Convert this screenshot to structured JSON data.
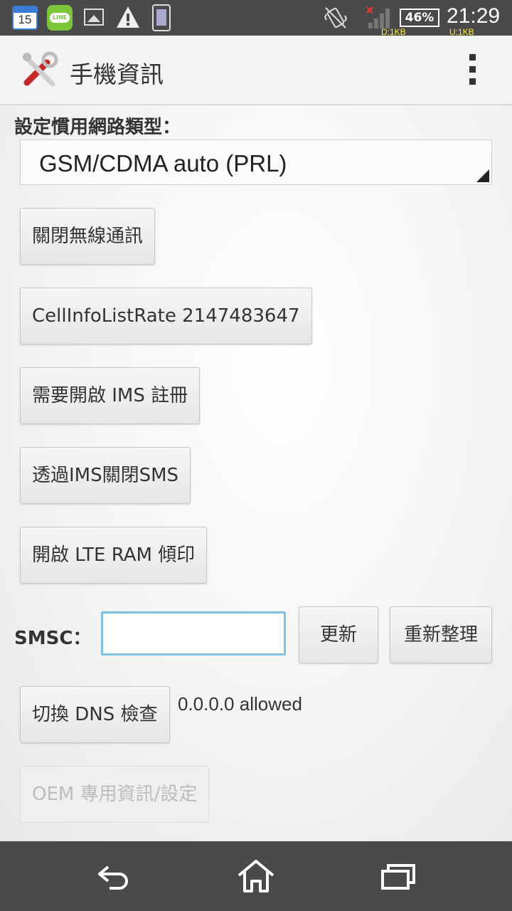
{
  "status_bar": {
    "calendar_day": "15",
    "line_label": "LINE",
    "battery": "46%",
    "time": "21:29",
    "download": "D:1KB",
    "upload": "U:1KB"
  },
  "action_bar": {
    "title": "手機資訊"
  },
  "content": {
    "preferred_network_label": "設定慣用網路類型：",
    "preferred_network_value": "GSM/CDMA auto (PRL)",
    "buttons": {
      "radio_off": "關閉無線通訊",
      "cell_info_rate": "CellInfoListRate 2147483647",
      "ims_registration": "需要開啟 IMS 註冊",
      "sms_over_ims": "透過IMS關閉SMS",
      "lte_ram_dump": "開啟 LTE RAM 傾印",
      "smsc_update": "更新",
      "smsc_refresh": "重新整理",
      "dns_check": "切換 DNS 檢查",
      "oem_info": "OEM 專用資訊/設定"
    },
    "smsc_label": "SMSC：",
    "smsc_value": "",
    "dns_status": "0.0.0.0 allowed"
  },
  "colors": {
    "status_bar": "#4a4a4a",
    "input_focus": "#7fc2e0",
    "speed_text": "#ffeb3b"
  }
}
